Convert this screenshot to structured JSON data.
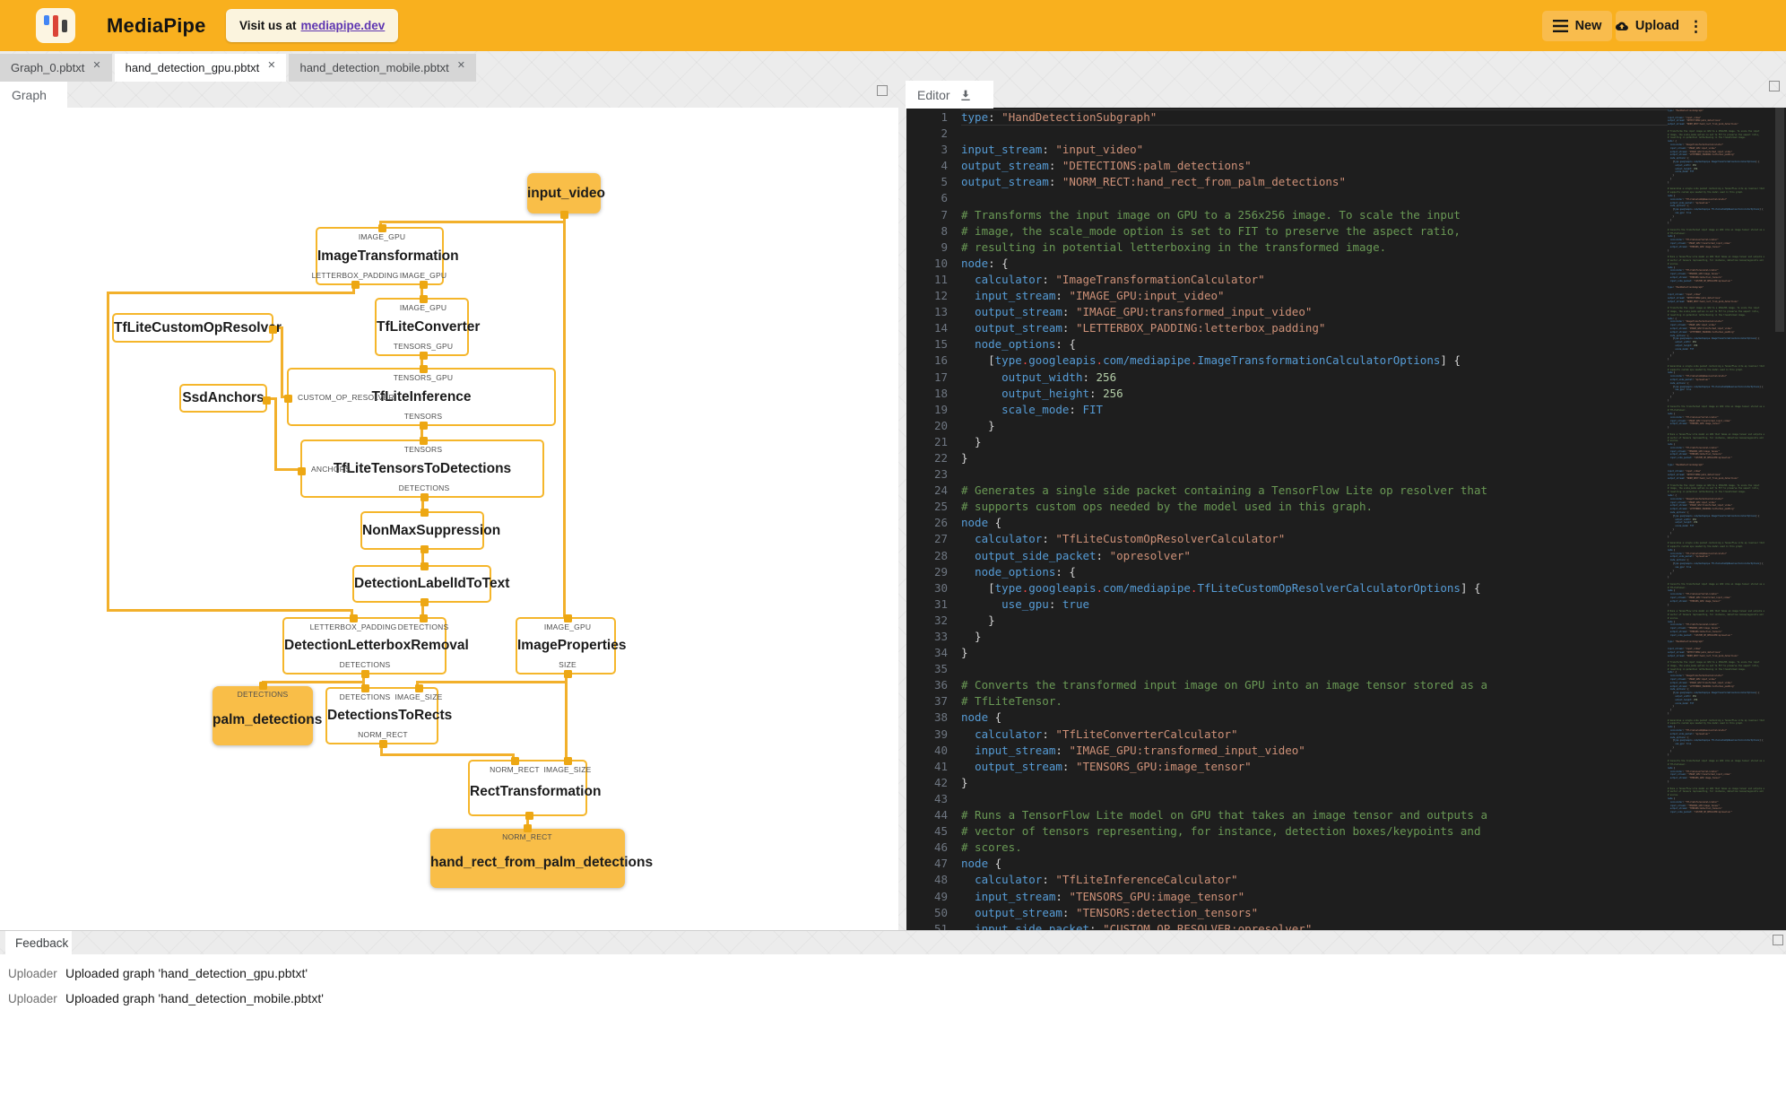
{
  "topbar": {
    "app_title": "MediaPipe",
    "visit_prefix": "Visit us at",
    "visit_link": "mediapipe.dev",
    "new_label": "New",
    "upload_label": "Upload"
  },
  "file_tabs": [
    {
      "label": "Graph_0.pbtxt",
      "active": false
    },
    {
      "label": "hand_detection_gpu.pbtxt",
      "active": true
    },
    {
      "label": "hand_detection_mobile.pbtxt",
      "active": false
    }
  ],
  "panels": {
    "graph_tab": "Graph",
    "editor_tab": "Editor",
    "feedback_tab": "Feedback"
  },
  "colors": {
    "topbar": "#F9B01E",
    "edge": "#F2B02B",
    "node_fill": "#F9BE48",
    "link": "#5E35B1"
  },
  "graph": {
    "nodes": [
      {
        "id": "input_video",
        "label": "input_video",
        "kind": "stream",
        "ports": {
          "bottom": [
            ""
          ]
        }
      },
      {
        "id": "ImageTransformation",
        "label": "ImageTransformation",
        "kind": "calculator",
        "ports": {
          "top": [
            "IMAGE_GPU"
          ],
          "bottom": [
            "LETTERBOX_PADDING",
            "IMAGE_GPU"
          ]
        }
      },
      {
        "id": "TfLiteConverter",
        "label": "TfLiteConverter",
        "kind": "calculator",
        "ports": {
          "top": [
            "IMAGE_GPU"
          ],
          "bottom": [
            "TENSORS_GPU"
          ]
        }
      },
      {
        "id": "TfLiteCustomOpResolver",
        "label": "TfLiteCustomOpResolver",
        "kind": "calculator",
        "ports": {
          "right": [
            ""
          ]
        }
      },
      {
        "id": "SsdAnchors",
        "label": "SsdAnchors",
        "kind": "calculator",
        "ports": {
          "right": [
            ""
          ]
        }
      },
      {
        "id": "TfLiteInference",
        "label": "TfLiteInference",
        "kind": "calculator",
        "ports": {
          "top": [
            "TENSORS_GPU"
          ],
          "left": [
            "CUSTOM_OP_RESOLVER"
          ],
          "bottom": [
            "TENSORS"
          ]
        }
      },
      {
        "id": "TfLiteTensorsToDetections",
        "label": "TfLiteTensorsToDetections",
        "kind": "calculator",
        "ports": {
          "top": [
            "TENSORS"
          ],
          "left": [
            "ANCHORS"
          ],
          "bottom": [
            "DETECTIONS"
          ]
        }
      },
      {
        "id": "NonMaxSuppression",
        "label": "NonMaxSuppression",
        "kind": "calculator",
        "ports": {
          "top": [
            ""
          ],
          "bottom": [
            ""
          ]
        }
      },
      {
        "id": "DetectionLabelIdToText",
        "label": "DetectionLabelIdToText",
        "kind": "calculator",
        "ports": {
          "top": [
            ""
          ],
          "bottom": [
            ""
          ]
        }
      },
      {
        "id": "DetectionLetterboxRemoval",
        "label": "DetectionLetterboxRemoval",
        "kind": "calculator",
        "ports": {
          "top": [
            "LETTERBOX_PADDING",
            "DETECTIONS"
          ],
          "bottom": [
            "DETECTIONS"
          ]
        }
      },
      {
        "id": "ImageProperties",
        "label": "ImageProperties",
        "kind": "calculator",
        "ports": {
          "top": [
            "IMAGE_GPU"
          ],
          "bottom": [
            "SIZE"
          ]
        }
      },
      {
        "id": "palm_detections",
        "label": "palm_detections",
        "kind": "stream",
        "ports": {
          "top": [
            "DETECTIONS"
          ]
        }
      },
      {
        "id": "DetectionsToRects",
        "label": "DetectionsToRects",
        "kind": "calculator",
        "ports": {
          "top": [
            "DETECTIONS",
            "IMAGE_SIZE"
          ],
          "bottom": [
            "NORM_RECT"
          ]
        }
      },
      {
        "id": "RectTransformation",
        "label": "RectTransformation",
        "kind": "calculator",
        "ports": {
          "top": [
            "NORM_RECT",
            "IMAGE_SIZE"
          ],
          "bottom": [
            ""
          ]
        }
      },
      {
        "id": "hand_rect_from_palm_detections",
        "label": "hand_rect_from_palm_detections",
        "kind": "stream",
        "ports": {
          "top": [
            "NORM_RECT"
          ]
        }
      }
    ]
  },
  "editor": {
    "lines": [
      "type: \"HandDetectionSubgraph\"",
      "",
      "input_stream: \"input_video\"",
      "output_stream: \"DETECTIONS:palm_detections\"",
      "output_stream: \"NORM_RECT:hand_rect_from_palm_detections\"",
      "",
      "# Transforms the input image on GPU to a 256x256 image. To scale the input",
      "# image, the scale_mode option is set to FIT to preserve the aspect ratio,",
      "# resulting in potential letterboxing in the transformed image.",
      "node: {",
      "  calculator: \"ImageTransformationCalculator\"",
      "  input_stream: \"IMAGE_GPU:input_video\"",
      "  output_stream: \"IMAGE_GPU:transformed_input_video\"",
      "  output_stream: \"LETTERBOX_PADDING:letterbox_padding\"",
      "  node_options: {",
      "    [type.googleapis.com/mediapipe.ImageTransformationCalculatorOptions] {",
      "      output_width: 256",
      "      output_height: 256",
      "      scale_mode: FIT",
      "    }",
      "  }",
      "}",
      "",
      "# Generates a single side packet containing a TensorFlow Lite op resolver that",
      "# supports custom ops needed by the model used in this graph.",
      "node {",
      "  calculator: \"TfLiteCustomOpResolverCalculator\"",
      "  output_side_packet: \"opresolver\"",
      "  node_options: {",
      "    [type.googleapis.com/mediapipe.TfLiteCustomOpResolverCalculatorOptions] {",
      "      use_gpu: true",
      "    }",
      "  }",
      "}",
      "",
      "# Converts the transformed input image on GPU into an image tensor stored as a",
      "# TfLiteTensor.",
      "node {",
      "  calculator: \"TfLiteConverterCalculator\"",
      "  input_stream: \"IMAGE_GPU:transformed_input_video\"",
      "  output_stream: \"TENSORS_GPU:image_tensor\"",
      "}",
      "",
      "# Runs a TensorFlow Lite model on GPU that takes an image tensor and outputs a",
      "# vector of tensors representing, for instance, detection boxes/keypoints and",
      "# scores.",
      "node {",
      "  calculator: \"TfLiteInferenceCalculator\"",
      "  input_stream: \"TENSORS_GPU:image_tensor\"",
      "  output_stream: \"TENSORS:detection_tensors\"",
      "  input_side_packet: \"CUSTOM_OP_RESOLVER:opresolver\""
    ]
  },
  "feedback": {
    "rows": [
      {
        "source": "Uploader",
        "message": "Uploaded graph 'hand_detection_gpu.pbtxt'"
      },
      {
        "source": "Uploader",
        "message": "Uploaded graph 'hand_detection_mobile.pbtxt'"
      }
    ]
  }
}
